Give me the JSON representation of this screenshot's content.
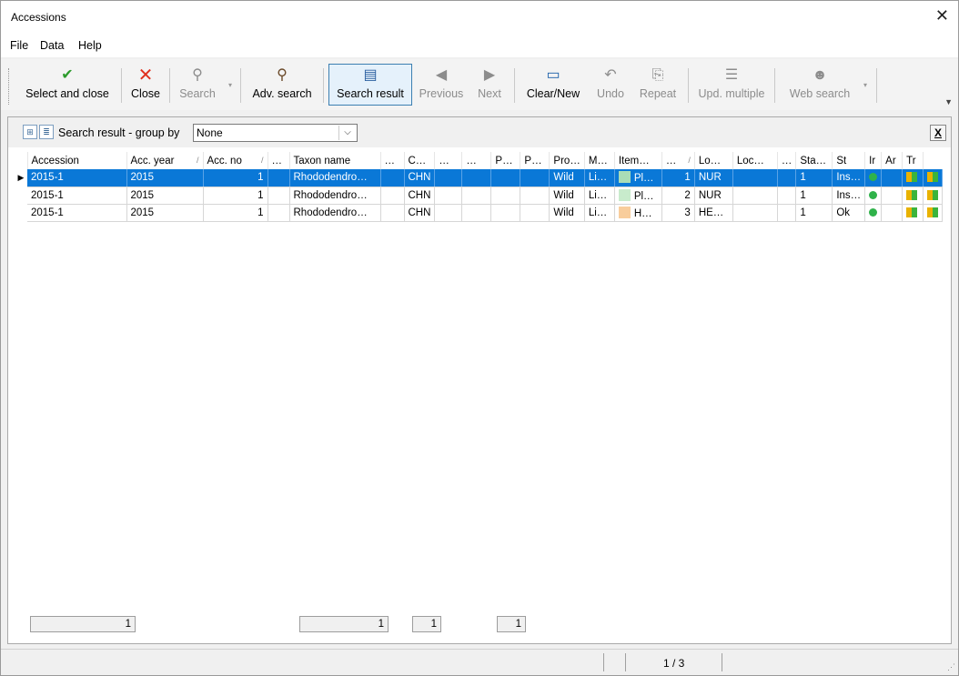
{
  "window": {
    "title": "Accessions",
    "close_glyph": "✕"
  },
  "menu": [
    "File",
    "Data",
    "Help"
  ],
  "toolbar": {
    "select_and_close": "Select and close",
    "close": "Close",
    "search": "Search",
    "adv_search": "Adv. search",
    "search_result": "Search result",
    "previous": "Previous",
    "next": "Next",
    "clear_new": "Clear/New",
    "undo": "Undo",
    "repeat": "Repeat",
    "upd_multiple": "Upd. multiple",
    "web_search": "Web search"
  },
  "groupby": {
    "label": "Search result - group by",
    "value": "None",
    "close": "X"
  },
  "columns": [
    "Accession",
    "Acc. year",
    "Acc. no",
    "…",
    "Taxon name",
    "…",
    "C…",
    "…",
    "…",
    "P…",
    "P…",
    "Pro…",
    "M…",
    "Item…",
    "…",
    "Lo…",
    "Loc…",
    "…",
    "Sta…",
    "St",
    "Ir",
    "Ar",
    "Tr"
  ],
  "rows": [
    {
      "accession": "2015-1",
      "year": "2015",
      "no": "1",
      "taxon": "Rhododendro…",
      "country": "CHN",
      "provenance": "Wild",
      "m": "Li…",
      "item": "Pl…",
      "item_color": "#a9dcb6",
      "itemno": "1",
      "loc": "NUR",
      "qty": "1",
      "status": "Ins…",
      "selected": true
    },
    {
      "accession": "2015-1",
      "year": "2015",
      "no": "1",
      "taxon": "Rhododendro…",
      "country": "CHN",
      "provenance": "Wild",
      "m": "Li…",
      "item": "Pl…",
      "item_color": "#c8ebcc",
      "itemno": "2",
      "loc": "NUR",
      "qty": "1",
      "status": "Ins…",
      "selected": false
    },
    {
      "accession": "2015-1",
      "year": "2015",
      "no": "1",
      "taxon": "Rhododendro…",
      "country": "CHN",
      "provenance": "Wild",
      "m": "Li…",
      "item": "H…",
      "item_color": "#f8cd9c",
      "itemno": "3",
      "loc": "HE…",
      "qty": "1",
      "status": "Ok",
      "selected": false
    }
  ],
  "totals": [
    "1",
    "1",
    "1",
    "1"
  ],
  "status": {
    "position": "1 / 3"
  }
}
